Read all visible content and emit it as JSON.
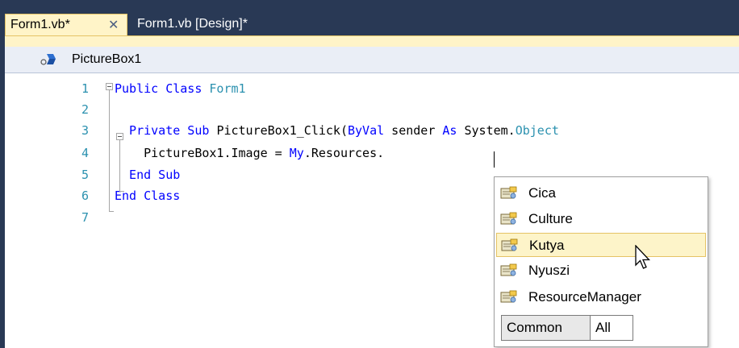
{
  "tabs": [
    {
      "label": "Form1.vb*",
      "active": true,
      "close_glyph": "✕"
    },
    {
      "label": "Form1.vb [Design]*",
      "active": false
    }
  ],
  "navbar": {
    "object": "PictureBox1",
    "icon": "field-icon"
  },
  "editor": {
    "line_numbers": [
      "1",
      "2",
      "3",
      "4",
      "5",
      "6",
      "7"
    ],
    "lines": [
      {
        "number": "1",
        "tokens": [
          {
            "t": "Public Class ",
            "c": "kw"
          },
          {
            "t": "Form1",
            "c": "ty"
          }
        ]
      },
      {
        "number": "2",
        "tokens": []
      },
      {
        "number": "3",
        "tokens": [
          {
            "t": "  Private Sub ",
            "c": "kw"
          },
          {
            "t": "PictureBox1_Click(",
            "c": "plain"
          },
          {
            "t": "ByVal",
            "c": "kw"
          },
          {
            "t": " sender ",
            "c": "plain"
          },
          {
            "t": "As",
            "c": "kw"
          },
          {
            "t": " System.",
            "c": "plain"
          },
          {
            "t": "Object",
            "c": "ty"
          }
        ]
      },
      {
        "number": "4",
        "tokens": [
          {
            "t": "    PictureBox1.Image = ",
            "c": "plain"
          },
          {
            "t": "My",
            "c": "kw"
          },
          {
            "t": ".Resources.",
            "c": "plain"
          }
        ]
      },
      {
        "number": "5",
        "tokens": [
          {
            "t": "  End Sub",
            "c": "kw"
          }
        ]
      },
      {
        "number": "6",
        "tokens": [
          {
            "t": "End Class",
            "c": "kw"
          }
        ]
      },
      {
        "number": "7",
        "tokens": []
      }
    ],
    "colors": {
      "keyword": "#0000ff",
      "type": "#2b91af",
      "line_number": "#2b91af"
    }
  },
  "completion_list": {
    "items": [
      {
        "label": "Cica",
        "icon": "property-icon",
        "selected": false
      },
      {
        "label": "Culture",
        "icon": "property-icon",
        "selected": false
      },
      {
        "label": "Kutya",
        "icon": "property-icon",
        "selected": true
      },
      {
        "label": "Nyuszi",
        "icon": "property-icon",
        "selected": false
      },
      {
        "label": "ResourceManager",
        "icon": "property-icon",
        "selected": false
      }
    ],
    "filter_tabs": {
      "common": "Common",
      "all": "All",
      "active": "All"
    }
  },
  "theme": {
    "chrome": "#293955",
    "active_tab": "#fff4c8",
    "selection": "#fdf4c9"
  }
}
